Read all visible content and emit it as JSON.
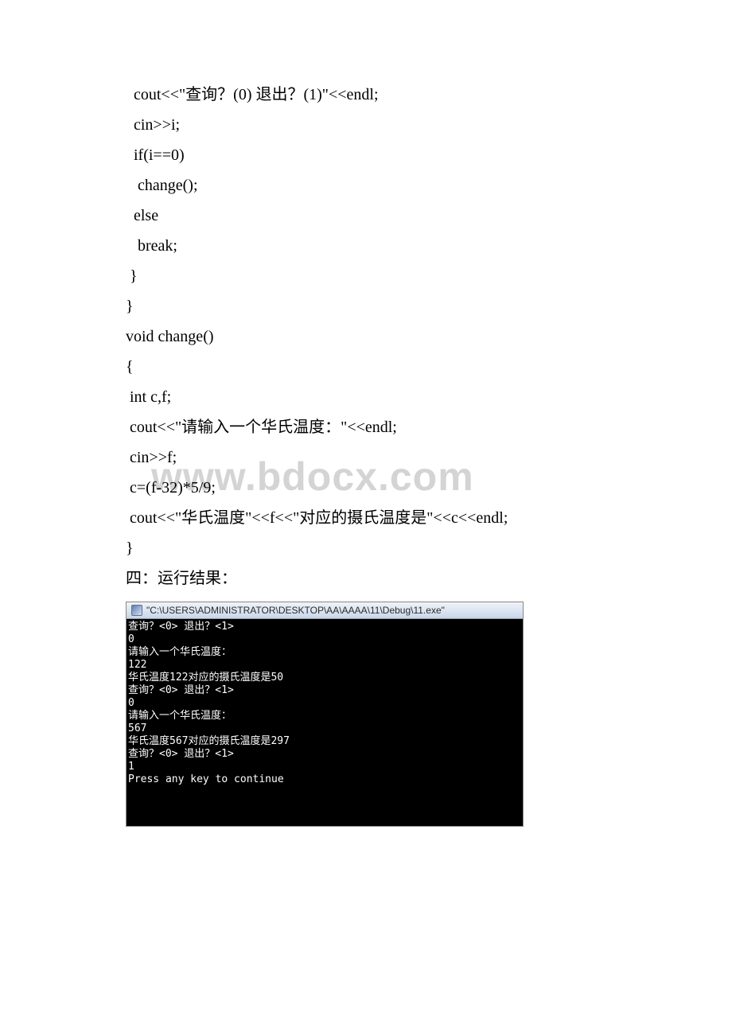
{
  "code": {
    "lines": [
      "  cout<<\"查询？(0) 退出？(1)\"<<endl;",
      "  cin>>i;",
      "  if(i==0)",
      "   change();",
      "  else",
      "   break;",
      " }",
      "",
      "}",
      "void change()",
      "{",
      " int c,f;",
      " cout<<\"请输入一个华氏温度：\"<<endl;",
      " cin>>f;",
      " c=(f-32)*5/9;",
      " cout<<\"华氏温度\"<<f<<\"对应的摄氏温度是\"<<c<<endl;",
      "}",
      "四：运行结果："
    ]
  },
  "watermark": "www.bdocx.com",
  "console": {
    "title": "\"C:\\USERS\\ADMINISTRATOR\\DESKTOP\\AA\\AAAA\\11\\Debug\\11.exe\"",
    "lines": [
      "查询？<0> 退出？<1>",
      "0",
      "请输入一个华氏温度：",
      "122",
      "华氏温度122对应的摄氏温度是50",
      "查询？<0> 退出？<1>",
      "0",
      "请输入一个华氏温度：",
      "567",
      "华氏温度567对应的摄氏温度是297",
      "查询？<0> 退出？<1>",
      "1",
      "Press any key to continue"
    ]
  }
}
